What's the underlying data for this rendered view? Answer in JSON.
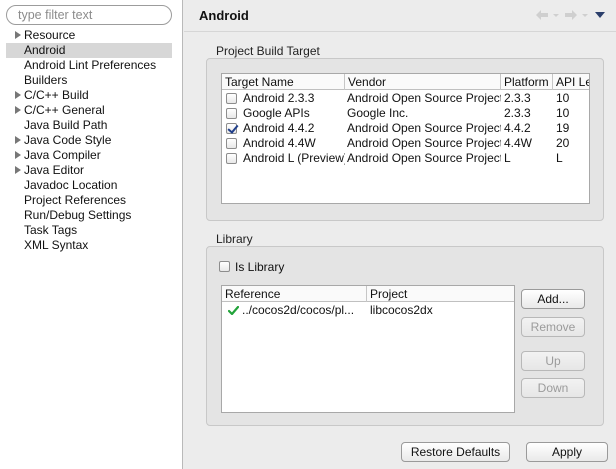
{
  "filter": {
    "placeholder": "type filter text"
  },
  "nav": {
    "items": [
      {
        "label": "Resource",
        "expandable": true
      },
      {
        "label": "Android",
        "selected": true
      },
      {
        "label": "Android Lint Preferences"
      },
      {
        "label": "Builders"
      },
      {
        "label": "C/C++ Build",
        "expandable": true
      },
      {
        "label": "C/C++ General",
        "expandable": true
      },
      {
        "label": "Java Build Path"
      },
      {
        "label": "Java Code Style",
        "expandable": true
      },
      {
        "label": "Java Compiler",
        "expandable": true
      },
      {
        "label": "Java Editor",
        "expandable": true
      },
      {
        "label": "Javadoc Location"
      },
      {
        "label": "Project References"
      },
      {
        "label": "Run/Debug Settings"
      },
      {
        "label": "Task Tags"
      },
      {
        "label": "XML Syntax"
      }
    ]
  },
  "header": {
    "title": "Android"
  },
  "build_target": {
    "section_label": "Project Build Target",
    "columns": [
      "Target Name",
      "Vendor",
      "Platform",
      "API Le"
    ],
    "rows": [
      {
        "name": "Android 2.3.3",
        "vendor": "Android Open Source Project",
        "platform": "2.3.3",
        "api": "10",
        "checked": false
      },
      {
        "name": "Google APIs",
        "vendor": "Google Inc.",
        "platform": "2.3.3",
        "api": "10",
        "checked": false
      },
      {
        "name": "Android 4.4.2",
        "vendor": "Android Open Source Project",
        "platform": "4.4.2",
        "api": "19",
        "checked": true
      },
      {
        "name": "Android 4.4W",
        "vendor": "Android Open Source Project",
        "platform": "4.4W",
        "api": "20",
        "checked": false
      },
      {
        "name": "Android L (Preview)",
        "vendor": "Android Open Source Project",
        "platform": "L",
        "api": "L",
        "checked": false
      }
    ]
  },
  "library": {
    "section_label": "Library",
    "is_library_label": "Is Library",
    "is_library_checked": false,
    "columns": [
      "Reference",
      "Project"
    ],
    "rows": [
      {
        "reference": "../cocos2d/cocos/pl...",
        "project": "libcocos2dx",
        "status": "ok"
      }
    ],
    "buttons": {
      "add": "Add...",
      "remove": "Remove",
      "up": "Up",
      "down": "Down"
    }
  },
  "footer": {
    "restore_defaults": "Restore Defaults",
    "apply": "Apply"
  },
  "colors": {
    "check_green": "#22a33a",
    "selected_row": "#d7d7d7",
    "checkbox_blue": "#1f3e8a"
  }
}
